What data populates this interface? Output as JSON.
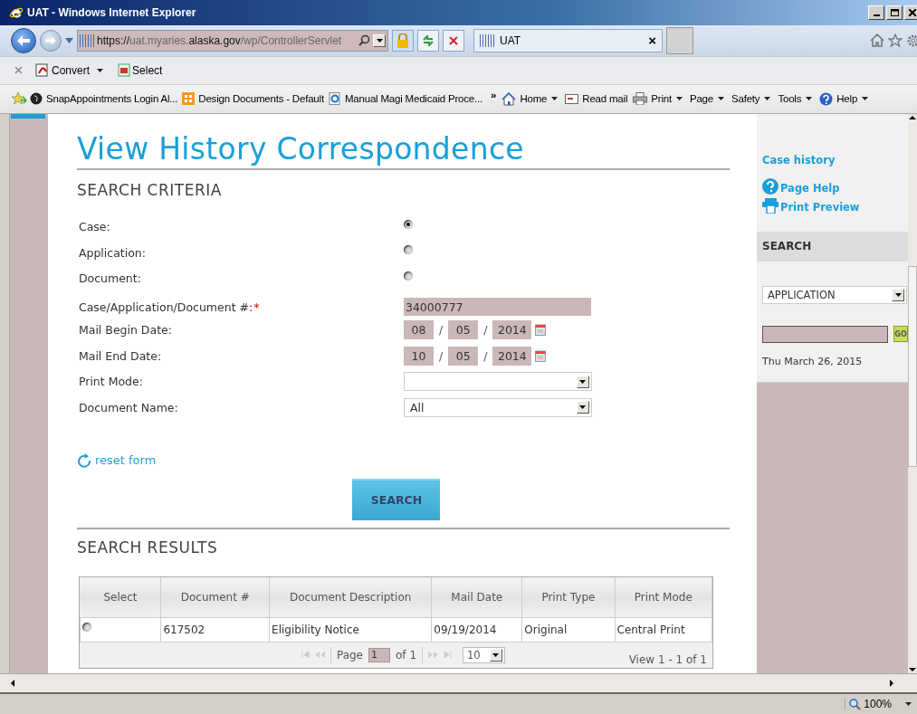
{
  "window": {
    "title": "UAT - Windows Internet Explorer"
  },
  "address_bar": {
    "scheme": "https://uat.myaries.",
    "host": "alaska.gov",
    "path": "/wp/ControllerServlet"
  },
  "tab": {
    "title": "UAT",
    "close": "×"
  },
  "command_bar": [
    {
      "label": "Convert",
      "kind": "pdf",
      "dropdown": true
    },
    {
      "label": "Select",
      "kind": "select",
      "dropdown": false
    }
  ],
  "favorites": [
    {
      "label": "SnapAppointments Login  Al...",
      "kind": "web"
    },
    {
      "label": "Design Documents - Default",
      "kind": "grid"
    },
    {
      "label": "Manual Magi Medicaid Proce...",
      "kind": "ie"
    }
  ],
  "more": "»",
  "tools": [
    {
      "label": "Home",
      "kind": "home",
      "dropdown": true
    },
    {
      "label": "Read mail",
      "kind": "mail",
      "dropdown": false
    },
    {
      "label": "Print",
      "kind": "print",
      "dropdown": true
    },
    {
      "label": "Page",
      "kind": "none",
      "dropdown": true
    },
    {
      "label": "Safety",
      "kind": "none",
      "dropdown": true
    },
    {
      "label": "Tools",
      "kind": "none",
      "dropdown": true
    },
    {
      "label": "Help",
      "kind": "help",
      "dropdown": true
    }
  ],
  "page": {
    "title": "View History Correspondence",
    "criteria_heading": "SEARCH CRITERIA",
    "search_by": [
      {
        "label": "Case:",
        "selected": true
      },
      {
        "label": "Application:",
        "selected": false
      },
      {
        "label": "Document:",
        "selected": false
      }
    ],
    "number_field": {
      "label": "Case/Application/Document #:",
      "required_mark": "*",
      "value": "34000777"
    },
    "date_fields": [
      {
        "label": "Mail Begin Date:",
        "month": "08",
        "day": "05",
        "year": "2014"
      },
      {
        "label": "Mail End Date:",
        "month": "10",
        "day": "05",
        "year": "2014"
      }
    ],
    "separator": "/",
    "selects": [
      {
        "label": "Print Mode:"
      },
      {
        "label": "Document Name:",
        "value": "All"
      }
    ],
    "reset_link": "reset form",
    "search_button": "SEARCH",
    "results_heading": "SEARCH RESULTS",
    "table": {
      "columns": [
        "Select",
        "Document #",
        "Document Description",
        "Mail Date",
        "Print Type",
        "Print Mode"
      ],
      "rows": [
        {
          "selected": false,
          "cells": [
            "",
            "617502",
            "Eligibility Notice",
            "09/19/2014",
            "Original",
            "Central Print"
          ]
        }
      ]
    },
    "pager": {
      "page_label": "Page",
      "page": "1",
      "of": "of 1",
      "page_size": "10",
      "view": "View 1 - 1 of 1"
    }
  },
  "sidebar": {
    "links": [
      {
        "label": "Case history",
        "kind": "plain"
      },
      {
        "label": "Page Help",
        "kind": "help"
      },
      {
        "label": "Print Preview",
        "kind": "print"
      }
    ],
    "search_heading": "SEARCH",
    "search_type": "APPLICATION",
    "go": "GO",
    "date": "Thu March 26, 2015"
  },
  "status_bar": {
    "zoom": "100%"
  }
}
